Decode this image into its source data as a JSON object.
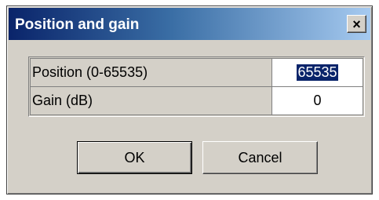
{
  "dialog": {
    "title": "Position and gain",
    "close_glyph": "×",
    "close_icon": "close-icon"
  },
  "fields": [
    {
      "label": "Position (0-65535)",
      "value": "65535",
      "selected": true
    },
    {
      "label": "Gain (dB)",
      "value": "0",
      "selected": false
    }
  ],
  "buttons": {
    "ok_label": "OK",
    "cancel_label": "Cancel"
  },
  "colors": {
    "title_gradient_start": "#0a246a",
    "title_gradient_end": "#a6caf0",
    "face": "#d4d0c8",
    "selection": "#0a246a"
  }
}
